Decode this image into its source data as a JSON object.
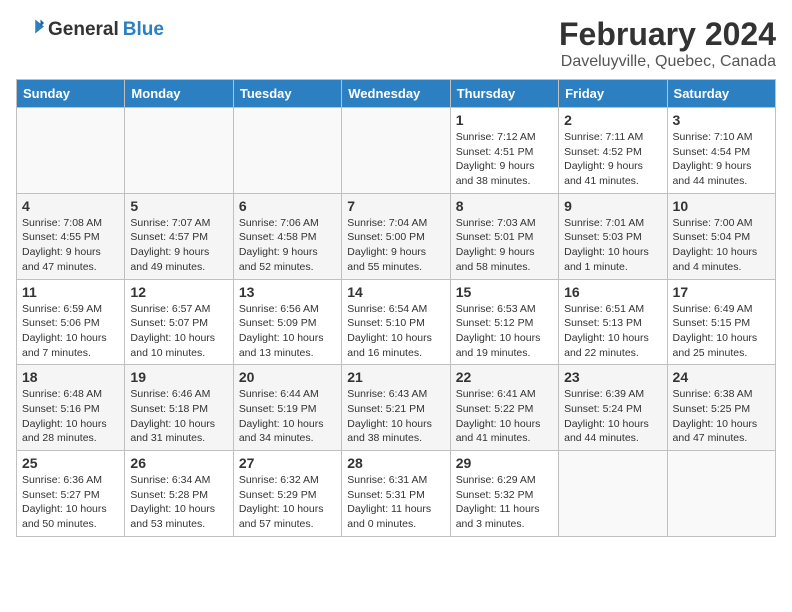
{
  "logo": {
    "general": "General",
    "blue": "Blue"
  },
  "header": {
    "title": "February 2024",
    "subtitle": "Daveluyville, Quebec, Canada"
  },
  "weekdays": [
    "Sunday",
    "Monday",
    "Tuesday",
    "Wednesday",
    "Thursday",
    "Friday",
    "Saturday"
  ],
  "weeks": [
    [
      {
        "day": "",
        "content": ""
      },
      {
        "day": "",
        "content": ""
      },
      {
        "day": "",
        "content": ""
      },
      {
        "day": "",
        "content": ""
      },
      {
        "day": "1",
        "content": "Sunrise: 7:12 AM\nSunset: 4:51 PM\nDaylight: 9 hours\nand 38 minutes."
      },
      {
        "day": "2",
        "content": "Sunrise: 7:11 AM\nSunset: 4:52 PM\nDaylight: 9 hours\nand 41 minutes."
      },
      {
        "day": "3",
        "content": "Sunrise: 7:10 AM\nSunset: 4:54 PM\nDaylight: 9 hours\nand 44 minutes."
      }
    ],
    [
      {
        "day": "4",
        "content": "Sunrise: 7:08 AM\nSunset: 4:55 PM\nDaylight: 9 hours\nand 47 minutes."
      },
      {
        "day": "5",
        "content": "Sunrise: 7:07 AM\nSunset: 4:57 PM\nDaylight: 9 hours\nand 49 minutes."
      },
      {
        "day": "6",
        "content": "Sunrise: 7:06 AM\nSunset: 4:58 PM\nDaylight: 9 hours\nand 52 minutes."
      },
      {
        "day": "7",
        "content": "Sunrise: 7:04 AM\nSunset: 5:00 PM\nDaylight: 9 hours\nand 55 minutes."
      },
      {
        "day": "8",
        "content": "Sunrise: 7:03 AM\nSunset: 5:01 PM\nDaylight: 9 hours\nand 58 minutes."
      },
      {
        "day": "9",
        "content": "Sunrise: 7:01 AM\nSunset: 5:03 PM\nDaylight: 10 hours\nand 1 minute."
      },
      {
        "day": "10",
        "content": "Sunrise: 7:00 AM\nSunset: 5:04 PM\nDaylight: 10 hours\nand 4 minutes."
      }
    ],
    [
      {
        "day": "11",
        "content": "Sunrise: 6:59 AM\nSunset: 5:06 PM\nDaylight: 10 hours\nand 7 minutes."
      },
      {
        "day": "12",
        "content": "Sunrise: 6:57 AM\nSunset: 5:07 PM\nDaylight: 10 hours\nand 10 minutes."
      },
      {
        "day": "13",
        "content": "Sunrise: 6:56 AM\nSunset: 5:09 PM\nDaylight: 10 hours\nand 13 minutes."
      },
      {
        "day": "14",
        "content": "Sunrise: 6:54 AM\nSunset: 5:10 PM\nDaylight: 10 hours\nand 16 minutes."
      },
      {
        "day": "15",
        "content": "Sunrise: 6:53 AM\nSunset: 5:12 PM\nDaylight: 10 hours\nand 19 minutes."
      },
      {
        "day": "16",
        "content": "Sunrise: 6:51 AM\nSunset: 5:13 PM\nDaylight: 10 hours\nand 22 minutes."
      },
      {
        "day": "17",
        "content": "Sunrise: 6:49 AM\nSunset: 5:15 PM\nDaylight: 10 hours\nand 25 minutes."
      }
    ],
    [
      {
        "day": "18",
        "content": "Sunrise: 6:48 AM\nSunset: 5:16 PM\nDaylight: 10 hours\nand 28 minutes."
      },
      {
        "day": "19",
        "content": "Sunrise: 6:46 AM\nSunset: 5:18 PM\nDaylight: 10 hours\nand 31 minutes."
      },
      {
        "day": "20",
        "content": "Sunrise: 6:44 AM\nSunset: 5:19 PM\nDaylight: 10 hours\nand 34 minutes."
      },
      {
        "day": "21",
        "content": "Sunrise: 6:43 AM\nSunset: 5:21 PM\nDaylight: 10 hours\nand 38 minutes."
      },
      {
        "day": "22",
        "content": "Sunrise: 6:41 AM\nSunset: 5:22 PM\nDaylight: 10 hours\nand 41 minutes."
      },
      {
        "day": "23",
        "content": "Sunrise: 6:39 AM\nSunset: 5:24 PM\nDaylight: 10 hours\nand 44 minutes."
      },
      {
        "day": "24",
        "content": "Sunrise: 6:38 AM\nSunset: 5:25 PM\nDaylight: 10 hours\nand 47 minutes."
      }
    ],
    [
      {
        "day": "25",
        "content": "Sunrise: 6:36 AM\nSunset: 5:27 PM\nDaylight: 10 hours\nand 50 minutes."
      },
      {
        "day": "26",
        "content": "Sunrise: 6:34 AM\nSunset: 5:28 PM\nDaylight: 10 hours\nand 53 minutes."
      },
      {
        "day": "27",
        "content": "Sunrise: 6:32 AM\nSunset: 5:29 PM\nDaylight: 10 hours\nand 57 minutes."
      },
      {
        "day": "28",
        "content": "Sunrise: 6:31 AM\nSunset: 5:31 PM\nDaylight: 11 hours\nand 0 minutes."
      },
      {
        "day": "29",
        "content": "Sunrise: 6:29 AM\nSunset: 5:32 PM\nDaylight: 11 hours\nand 3 minutes."
      },
      {
        "day": "",
        "content": ""
      },
      {
        "day": "",
        "content": ""
      }
    ]
  ]
}
